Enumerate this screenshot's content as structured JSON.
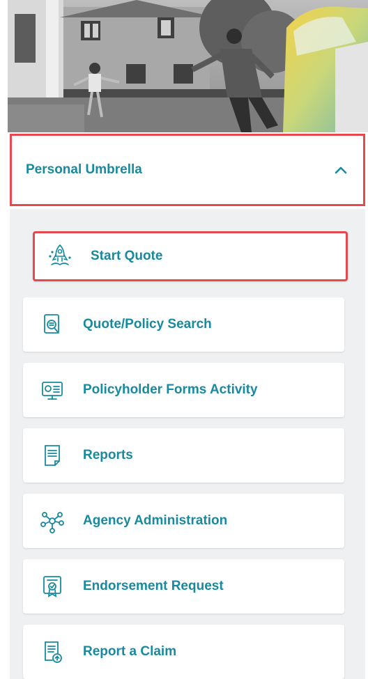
{
  "product": {
    "title": "Personal Umbrella",
    "chevron_icon": "chevron-up-icon"
  },
  "menu": {
    "items": [
      {
        "label": "Start Quote",
        "icon": "rocket-icon",
        "selected": true
      },
      {
        "label": "Quote/Policy Search",
        "icon": "document-search-icon",
        "selected": false
      },
      {
        "label": "Policyholder Forms Activity",
        "icon": "monitor-form-icon",
        "selected": false
      },
      {
        "label": "Reports",
        "icon": "report-document-icon",
        "selected": false
      },
      {
        "label": "Agency Administration",
        "icon": "network-nodes-icon",
        "selected": false
      },
      {
        "label": "Endorsement Request",
        "icon": "certificate-icon",
        "selected": false
      },
      {
        "label": "Report a Claim",
        "icon": "claim-upload-icon",
        "selected": false
      }
    ]
  },
  "colors": {
    "accent": "#178aa0",
    "highlight_border": "#e5484d",
    "panel_background": "#eef0f2"
  }
}
